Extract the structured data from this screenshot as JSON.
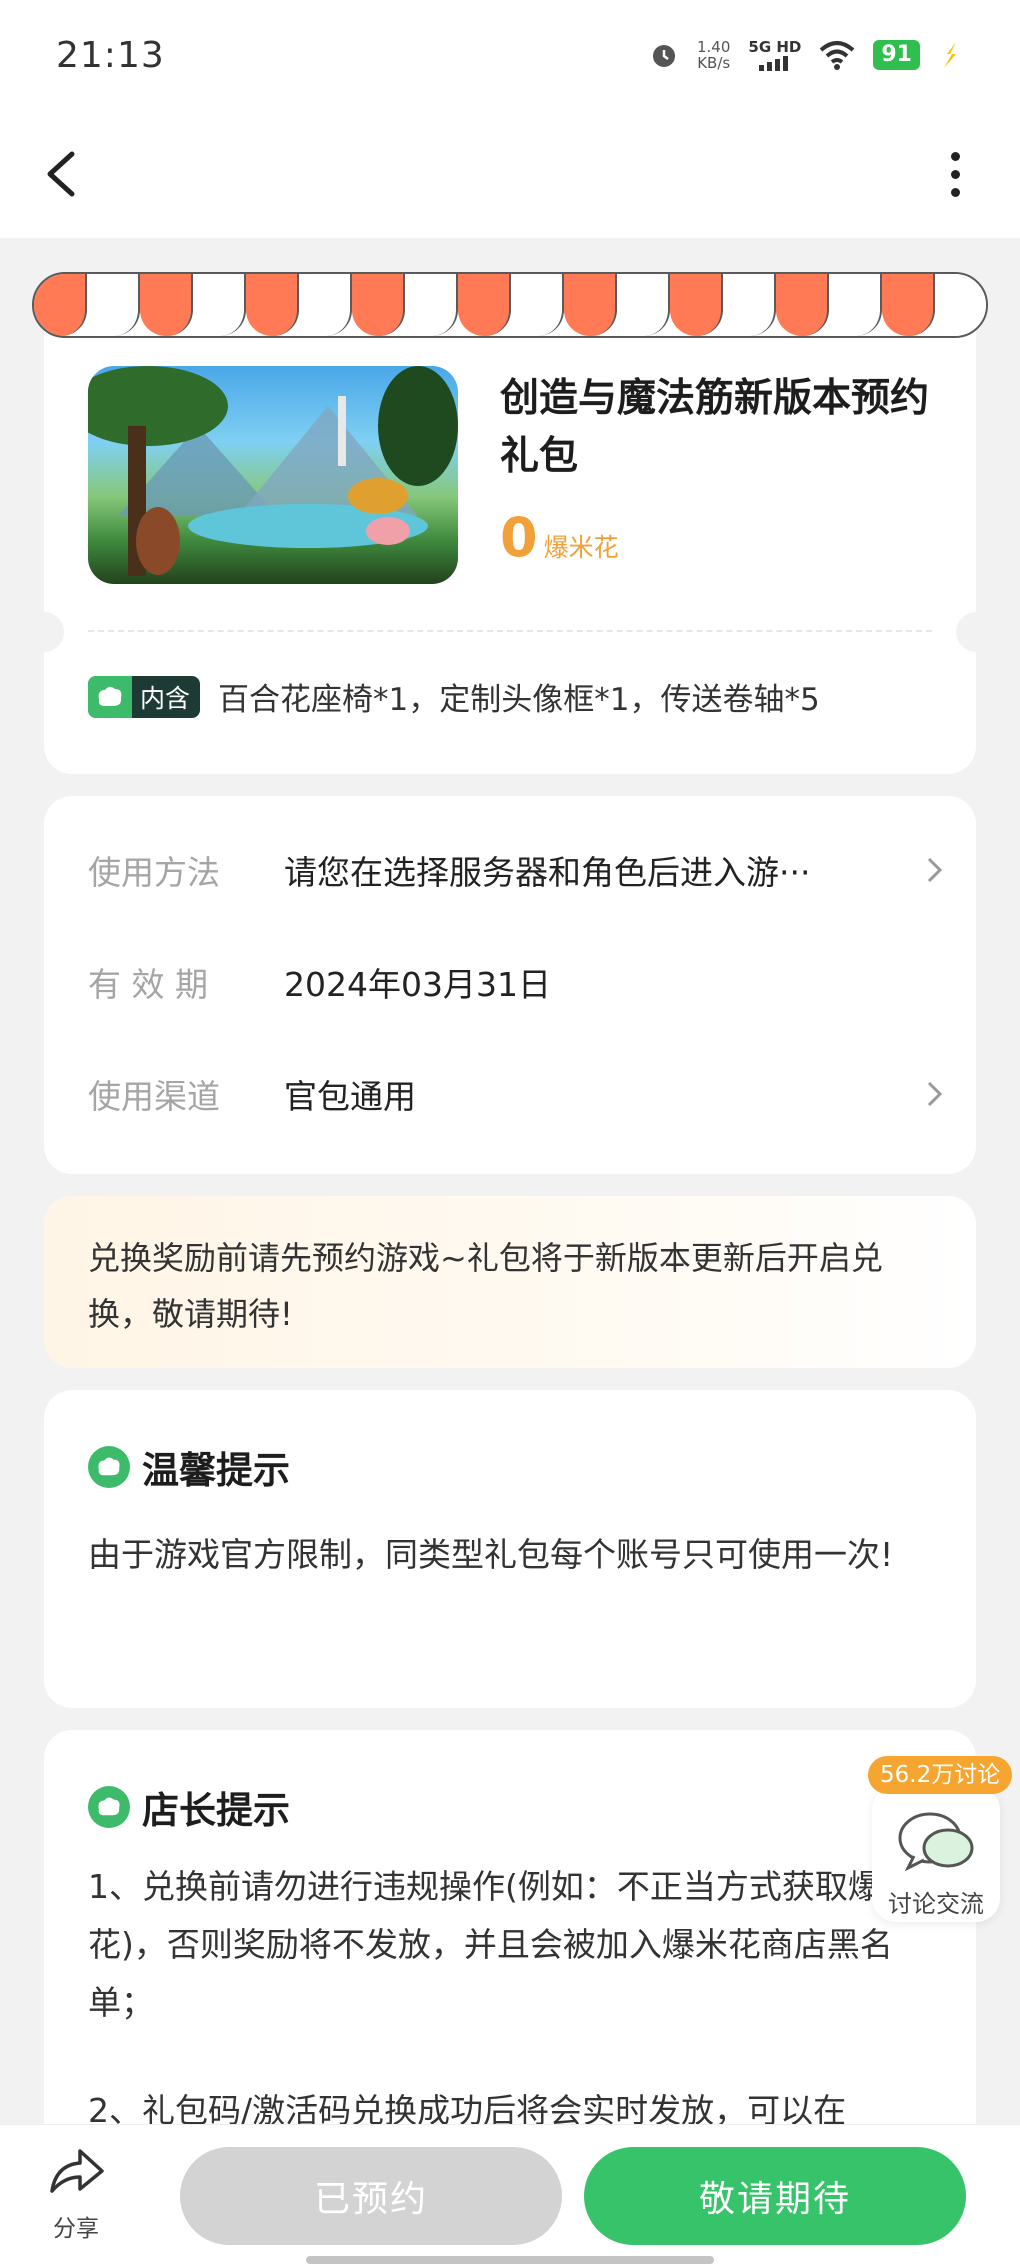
{
  "status_bar": {
    "time": "21:13",
    "net_speed": "1.40",
    "net_unit": "KB/s",
    "network": "5G HD",
    "battery": "91",
    "icons": [
      "alarm-icon",
      "signal-icon",
      "wifi-icon",
      "battery-icon",
      "charging-icon"
    ]
  },
  "nav": {
    "back_icon": "back-arrow-icon",
    "more_icon": "more-vertical-icon"
  },
  "gift": {
    "title": "创造与魔法筋新版本预约礼包",
    "price": "0",
    "price_unit": "爆米花",
    "contains_tag": "内含",
    "contains_text": "百合花座椅*1，定制头像框*1，传送卷轴*5"
  },
  "info": {
    "rows": [
      {
        "label": "使用方法",
        "value": "请您在选择服务器和角色后进入游···"
      },
      {
        "label": "有 效 期",
        "value": "2024年03月31日"
      },
      {
        "label": "使用渠道",
        "value": "官包通用"
      }
    ]
  },
  "notice": "兑换奖励前请先预约游戏~礼包将于新版本更新后开启兑换，敬请期待!",
  "warm_tip": {
    "title": "温馨提示",
    "body": "由于游戏官方限制，同类型礼包每个账号只可使用一次!"
  },
  "shop_tip": {
    "title": "店长提示",
    "item1": "1、兑换前请勿进行违规操作(例如：不正当方式获取爆米花)，否则奖励将不发放，并且会被加入爆米花商店黑名单；",
    "item2": "2、礼包码/激活码兑换成功后将会实时发放，可以在"
  },
  "discuss": {
    "badge": "56.2万讨论",
    "label": "讨论交流"
  },
  "bottom": {
    "share_label": "分享",
    "reserved_label": "已预约",
    "await_label": "敬请期待"
  },
  "colors": {
    "accent_green": "#36c36a",
    "price_orange": "#f2a13a",
    "awning_orange": "#ff7a55",
    "badge_orange": "#f6a531"
  }
}
